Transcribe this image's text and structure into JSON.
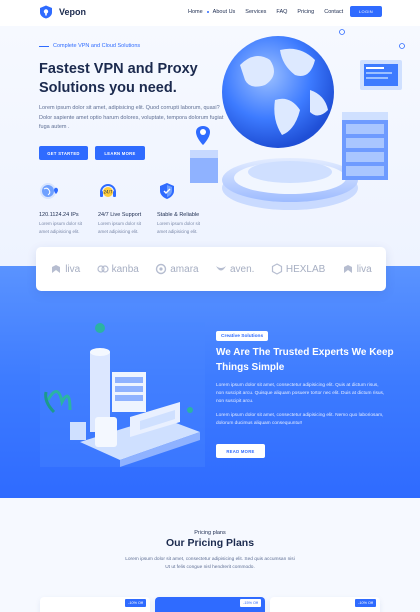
{
  "header": {
    "brand": "Vepon",
    "nav": [
      "Home",
      "About Us",
      "Services",
      "FAQ",
      "Pricing",
      "Contact"
    ],
    "login_label": "LOGIN"
  },
  "hero": {
    "tagline": "Complete VPN and Cloud Solutions",
    "title": "Fastest VPN and Proxy Solutions you need.",
    "description": "Lorem ipsum dolor sit amet, adipisicing elit. Quod corrupti laborum, quasi? Dolor sapiente amet optio harum dolores, voluptate, tempora dolorum fugiat fuga autem .",
    "get_started_label": "GET STARTED",
    "learn_more_label": "LEARN MORE",
    "features": [
      {
        "icon": "globe-pin-icon",
        "title": "120.1124.24 IPs",
        "desc": "Lorem ipsum dolor sit amet adipisicing elit."
      },
      {
        "icon": "headset-24-7-icon",
        "title": "24/7 Live Support",
        "desc": "Lorem ipsum dolor sit amet adipisicing elit."
      },
      {
        "icon": "shield-icon",
        "title": "Stable & Reliable",
        "desc": "Lorem ipsum dolor sit amet adipisicing elit."
      }
    ]
  },
  "brands": [
    "liva",
    "kanba",
    "amara",
    "aven.",
    "HEXLAB",
    "liva"
  ],
  "experts": {
    "badge": "Creative Solutions",
    "title": "We Are The Trusted Experts We Keep Things Simple",
    "p1": "Lorem ipsum dolor sit amet, consectetur adipisicing elit. Quis at dictum risus, non suscipit arcu. Quisque aliquam posuere tortor nec elit. Duis at dictum risus, non suscipit arcu.",
    "p2": "Lorem ipsum dolor sit amet, consectetur adipisicing elit. Nemo quo laboriosam, dolorum ducimus aliquam consequuntur!",
    "button_label": "READ MORE"
  },
  "pricing": {
    "subtitle": "Pricing plans",
    "title": "Our Pricing Plans",
    "description": "Lorem ipsum dolor sit amet, consectetur adipisicing elit. Sed quis accumsan nisi Ut ut felis congue nisl hendrerit commodo.",
    "cards": [
      {
        "discount": "-10% Off"
      },
      {
        "discount": "-15% Off"
      },
      {
        "discount": "-10% Off"
      }
    ]
  },
  "colors": {
    "accent": "#2f6bff",
    "heading": "#1b2a4e",
    "muted": "#5f6f94"
  }
}
